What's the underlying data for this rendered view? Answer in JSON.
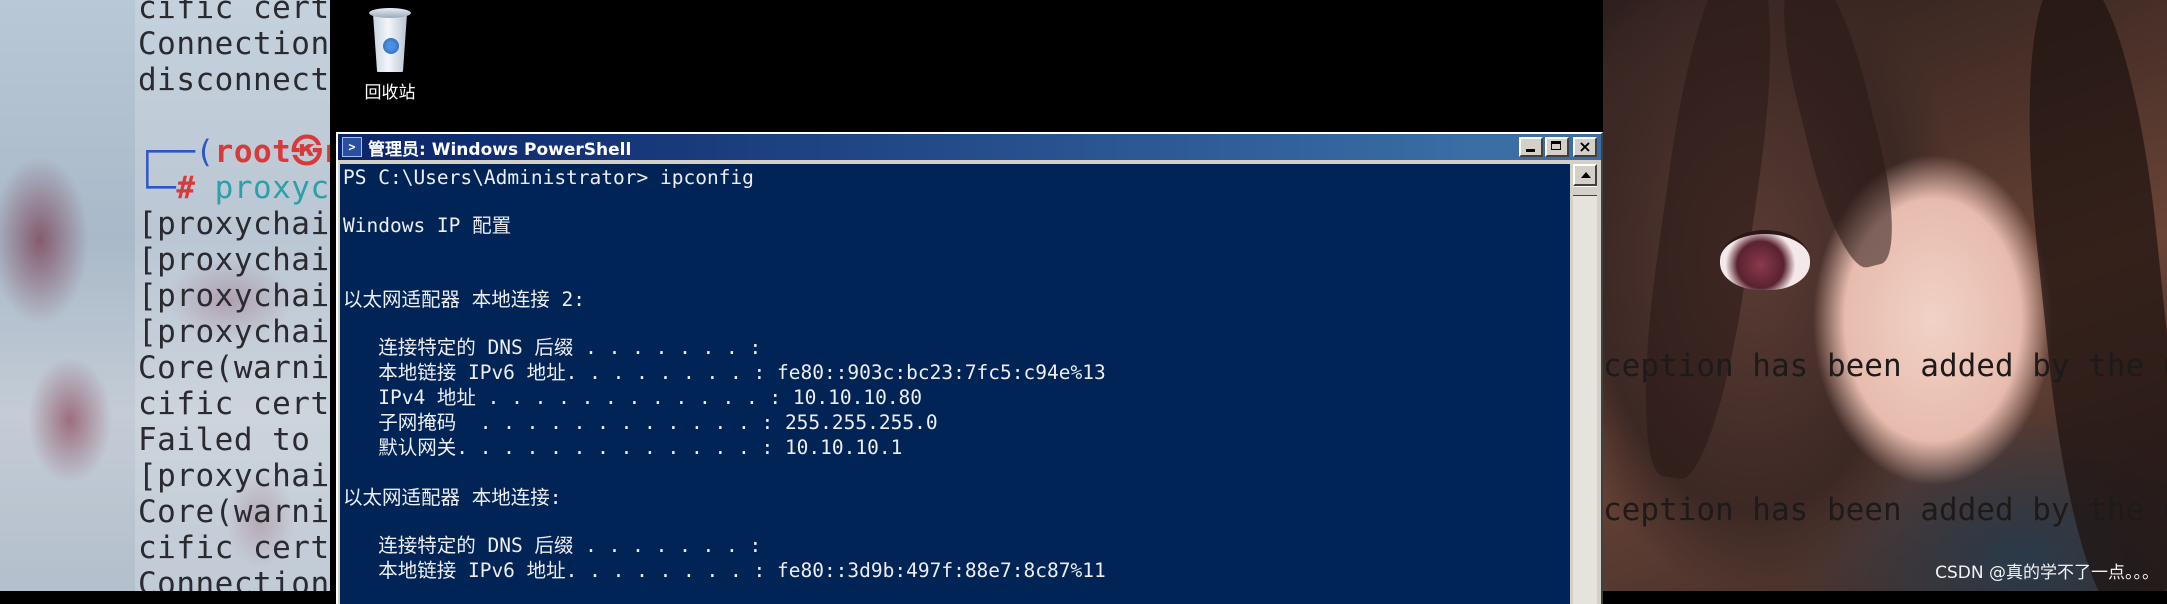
{
  "left_terminal": {
    "lines": [
      "cific certi",
      "Connection ",
      "disconnect:",
      "",
      "[proxychain",
      "[proxychain",
      "[proxychain",
      "[proxychain",
      "Core(warnir",
      "cific certi",
      "Failed to i",
      "[proxychain",
      "Core(warnir",
      "cific certi",
      "Connection "
    ],
    "prompt_open": "┌──(",
    "prompt_user": "root㉿r",
    "prompt_hash_line": "└─",
    "prompt_hash": "# ",
    "prompt_cmd": "proxych"
  },
  "desktop": {
    "recycle_bin_label": "回收站"
  },
  "powershell": {
    "icon_glyph": ">",
    "title": "管理员: Windows PowerShell",
    "lines": [
      "PS C:\\Users\\Administrator> ipconfig",
      "",
      "Windows IP 配置",
      "",
      "",
      "以太网适配器 本地连接 2:",
      "",
      "   连接特定的 DNS 后缀 . . . . . . . :",
      "   本地链接 IPv6 地址. . . . . . . . : fe80::903c:bc23:7fc5:c94e%13",
      "   IPv4 地址 . . . . . . . . . . . . : 10.10.10.80",
      "   子网掩码  . . . . . . . . . . . . : 255.255.255.0",
      "   默认网关. . . . . . . . . . . . . : 10.10.10.1",
      "",
      "以太网适配器 本地连接:",
      "",
      "   连接特定的 DNS 后缀 . . . . . . . :",
      "   本地链接 IPv6 地址. . . . . . . . : fe80::3d9b:497f:88e7:8c87%11"
    ]
  },
  "right_terminal": {
    "lines": [
      "ception has been added by the use",
      "ception has been added by the use"
    ]
  },
  "watermark": "CSDN @真的学不了一点。。。"
}
